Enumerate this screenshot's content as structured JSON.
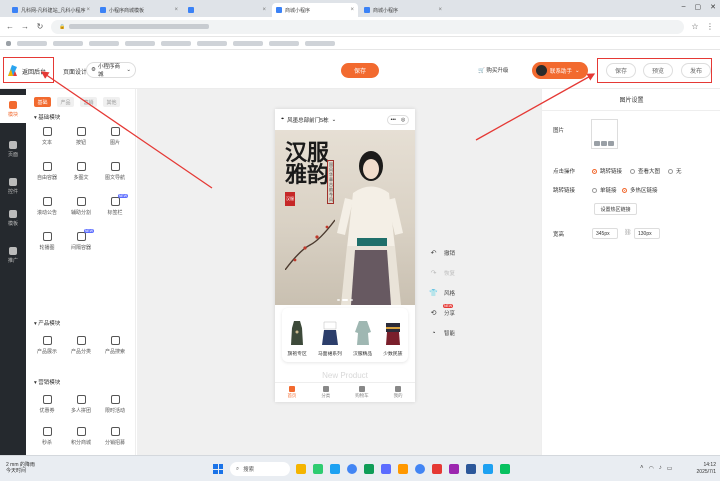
{
  "browser": {
    "tabs": [
      {
        "label": "凡科网-凡科建站_凡科小程序",
        "active": false
      },
      {
        "label": "小程序商城模板",
        "active": false
      },
      {
        "label": "",
        "active": false
      },
      {
        "label": "商城小程序",
        "active": true
      },
      {
        "label": "商城小程序",
        "active": false
      }
    ]
  },
  "header": {
    "back_label": "返回后台",
    "design_label": "页面设计",
    "store_select": "小程序商城",
    "save_label": "保存",
    "upgrade_label": "购买升级",
    "user_label": "联系助手",
    "btn_save": "保存",
    "btn_preview": "预览",
    "btn_publish": "发布"
  },
  "rail": {
    "items": [
      "模块",
      "页面",
      "控件",
      "模板",
      "推广"
    ]
  },
  "panel": {
    "tabs": [
      "基础",
      "产品",
      "营销",
      "其他"
    ],
    "sections": {
      "basic": "基础模块",
      "product": "产品模块",
      "marketing": "营销模块"
    },
    "basic_items": [
      "文本",
      "按钮",
      "图片",
      "自由容器",
      "多图文",
      "图文导航",
      "滚动公告",
      "辅助分割",
      "标签栏",
      "轮播图",
      "间隔容器"
    ],
    "product_items": [
      "产品展示",
      "产品分类",
      "产品搜索"
    ],
    "marketing_items": [
      "优惠券",
      "多人拼团",
      "限时活动",
      "秒杀",
      "积分商城",
      "分销招募"
    ],
    "badges": {
      "new": "NEW"
    }
  },
  "phone": {
    "store_name": "风墨总部前门5栋",
    "hero_title": "汉服雅韵",
    "hero_seal": "汉服",
    "hero_sub": "国风华章 古韵今风",
    "categories": [
      "旗袍专区",
      "马面裙系列",
      "汉服精品",
      "少数民族"
    ],
    "new_product": "New Product",
    "nav": [
      "首页",
      "分类",
      "购物车",
      "我的"
    ]
  },
  "sidetools": {
    "items": [
      "撤销",
      "恢复",
      "风格",
      "分享",
      "智能"
    ],
    "new_badge": "NEW"
  },
  "settings": {
    "title": "图片设置",
    "image_label": "图片",
    "click_label": "点击操作",
    "click_options": [
      "跳转链接",
      "查看大图",
      "无"
    ],
    "link_label": "跳转链接",
    "link_options": [
      "单链接",
      "多热区链接"
    ],
    "hotzone_button": "设置热区链接",
    "size_label": "宽高",
    "width_value": "345px",
    "height_value": "130px"
  },
  "taskbar": {
    "weather": "2 mm 的降雨",
    "weather_sub": "今天时间",
    "search": "搜索",
    "time": "14:12",
    "date": "2025/7/1"
  },
  "colors": {
    "accent": "#f26a2f",
    "highlight": "#e53935",
    "rail": "#25292e"
  }
}
